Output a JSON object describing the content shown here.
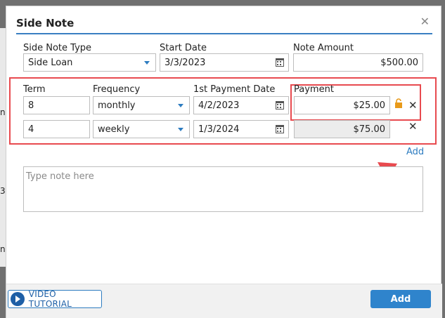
{
  "dialog": {
    "title": "Side Note"
  },
  "row1": {
    "type_label": "Side Note Type",
    "type_value": "Side Loan",
    "start_label": "Start Date",
    "start_value": "3/3/2023",
    "amount_label": "Note Amount",
    "amount_value": "$500.00"
  },
  "schedule": {
    "headers": {
      "term": "Term",
      "frequency": "Frequency",
      "first_payment": "1st Payment Date",
      "payment": "Payment"
    },
    "rows": [
      {
        "term": "8",
        "frequency": "monthly",
        "first_payment": "4/2/2023",
        "payment": "$25.00"
      },
      {
        "term": "4",
        "frequency": "weekly",
        "first_payment": "1/3/2024",
        "payment": "$75.00"
      }
    ]
  },
  "add_link": "Add",
  "note": {
    "placeholder": "Type note here"
  },
  "footer": {
    "video_label": "VIDEO TUTORIAL",
    "add_label": "Add"
  },
  "background": {
    "snippets": [
      "ni",
      "3",
      "ni"
    ]
  },
  "icons": {
    "close": "close-icon",
    "calendar": "calendar-icon",
    "caret": "chevron-down-icon",
    "lock": "unlock-icon",
    "remove": "remove-icon",
    "play": "play-icon",
    "arrow": "arrow-icon"
  },
  "colors": {
    "accent": "#2d7cc0",
    "highlight": "#e84a4f",
    "lock": "#e89a1a"
  }
}
